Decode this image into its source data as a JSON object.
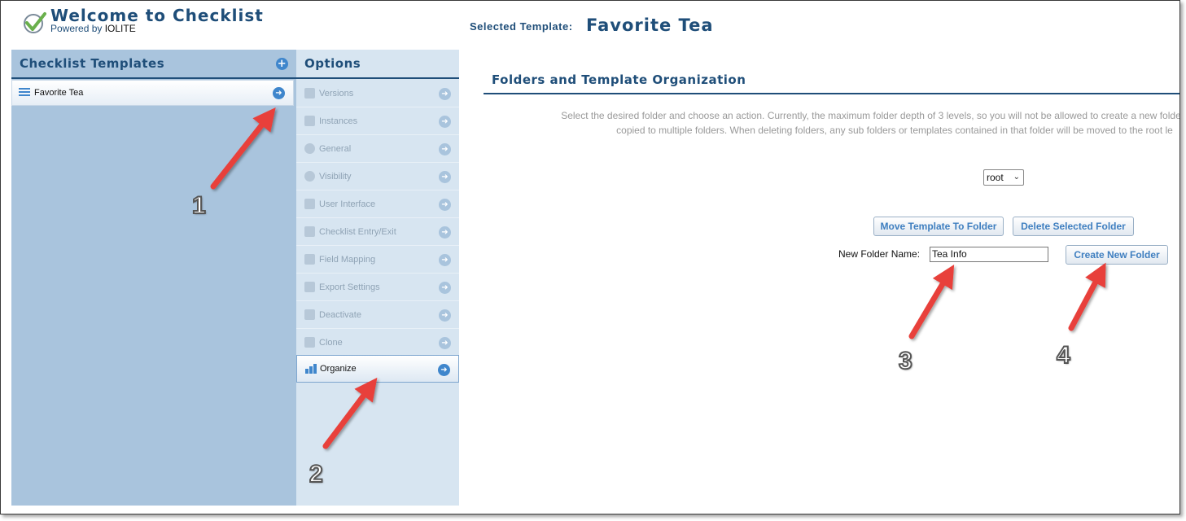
{
  "header": {
    "app_title": "Welcome to Checklist",
    "powered_prefix": "Powered by",
    "powered_brand": "IOLITE",
    "selected_label": "Selected Template:",
    "selected_name": "Favorite Tea"
  },
  "templates_panel": {
    "title": "Checklist Templates",
    "items": [
      {
        "label": "Favorite Tea"
      }
    ]
  },
  "options_panel": {
    "title": "Options",
    "items": [
      {
        "label": "Versions",
        "icon": "versions-icon",
        "active": false
      },
      {
        "label": "Instances",
        "icon": "instances-icon",
        "active": false
      },
      {
        "label": "General",
        "icon": "gear-icon",
        "active": false
      },
      {
        "label": "Visibility",
        "icon": "visibility-icon",
        "active": false
      },
      {
        "label": "User Interface",
        "icon": "window-icon",
        "active": false
      },
      {
        "label": "Checklist Entry/Exit",
        "icon": "entry-exit-icon",
        "active": false
      },
      {
        "label": "Field Mapping",
        "icon": "hierarchy-icon",
        "active": false
      },
      {
        "label": "Export Settings",
        "icon": "export-icon",
        "active": false
      },
      {
        "label": "Deactivate",
        "icon": "trash-icon",
        "active": false
      },
      {
        "label": "Clone",
        "icon": "clone-icon",
        "active": false
      },
      {
        "label": "Organize",
        "icon": "bar-chart-icon",
        "active": true
      }
    ]
  },
  "main": {
    "section_title": "Folders and Template Organization",
    "description_line1": "Select the desired folder and choose an action. Currently, the maximum folder depth of 3 levels, so you will not be allowed to create a new folder deeper th",
    "description_line2": "copied to multiple folders. When deleting folders, any sub folders or templates contained in that folder will be moved to the root le",
    "folder_select_value": "root",
    "move_button": "Move Template To Folder",
    "delete_button": "Delete Selected Folder",
    "new_folder_label": "New Folder Name:",
    "new_folder_value": "Tea Info",
    "create_button": "Create New Folder"
  },
  "annotations": {
    "step1": "1",
    "step2": "2",
    "step3": "3",
    "step4": "4"
  },
  "colors": {
    "brand_blue": "#1f4e79",
    "accent_blue": "#3f86cc",
    "templates_bg": "#a9c4dd",
    "options_bg": "#d7e5f1",
    "arrow_red": "#e8413a",
    "logo_green": "#6ab04c"
  }
}
